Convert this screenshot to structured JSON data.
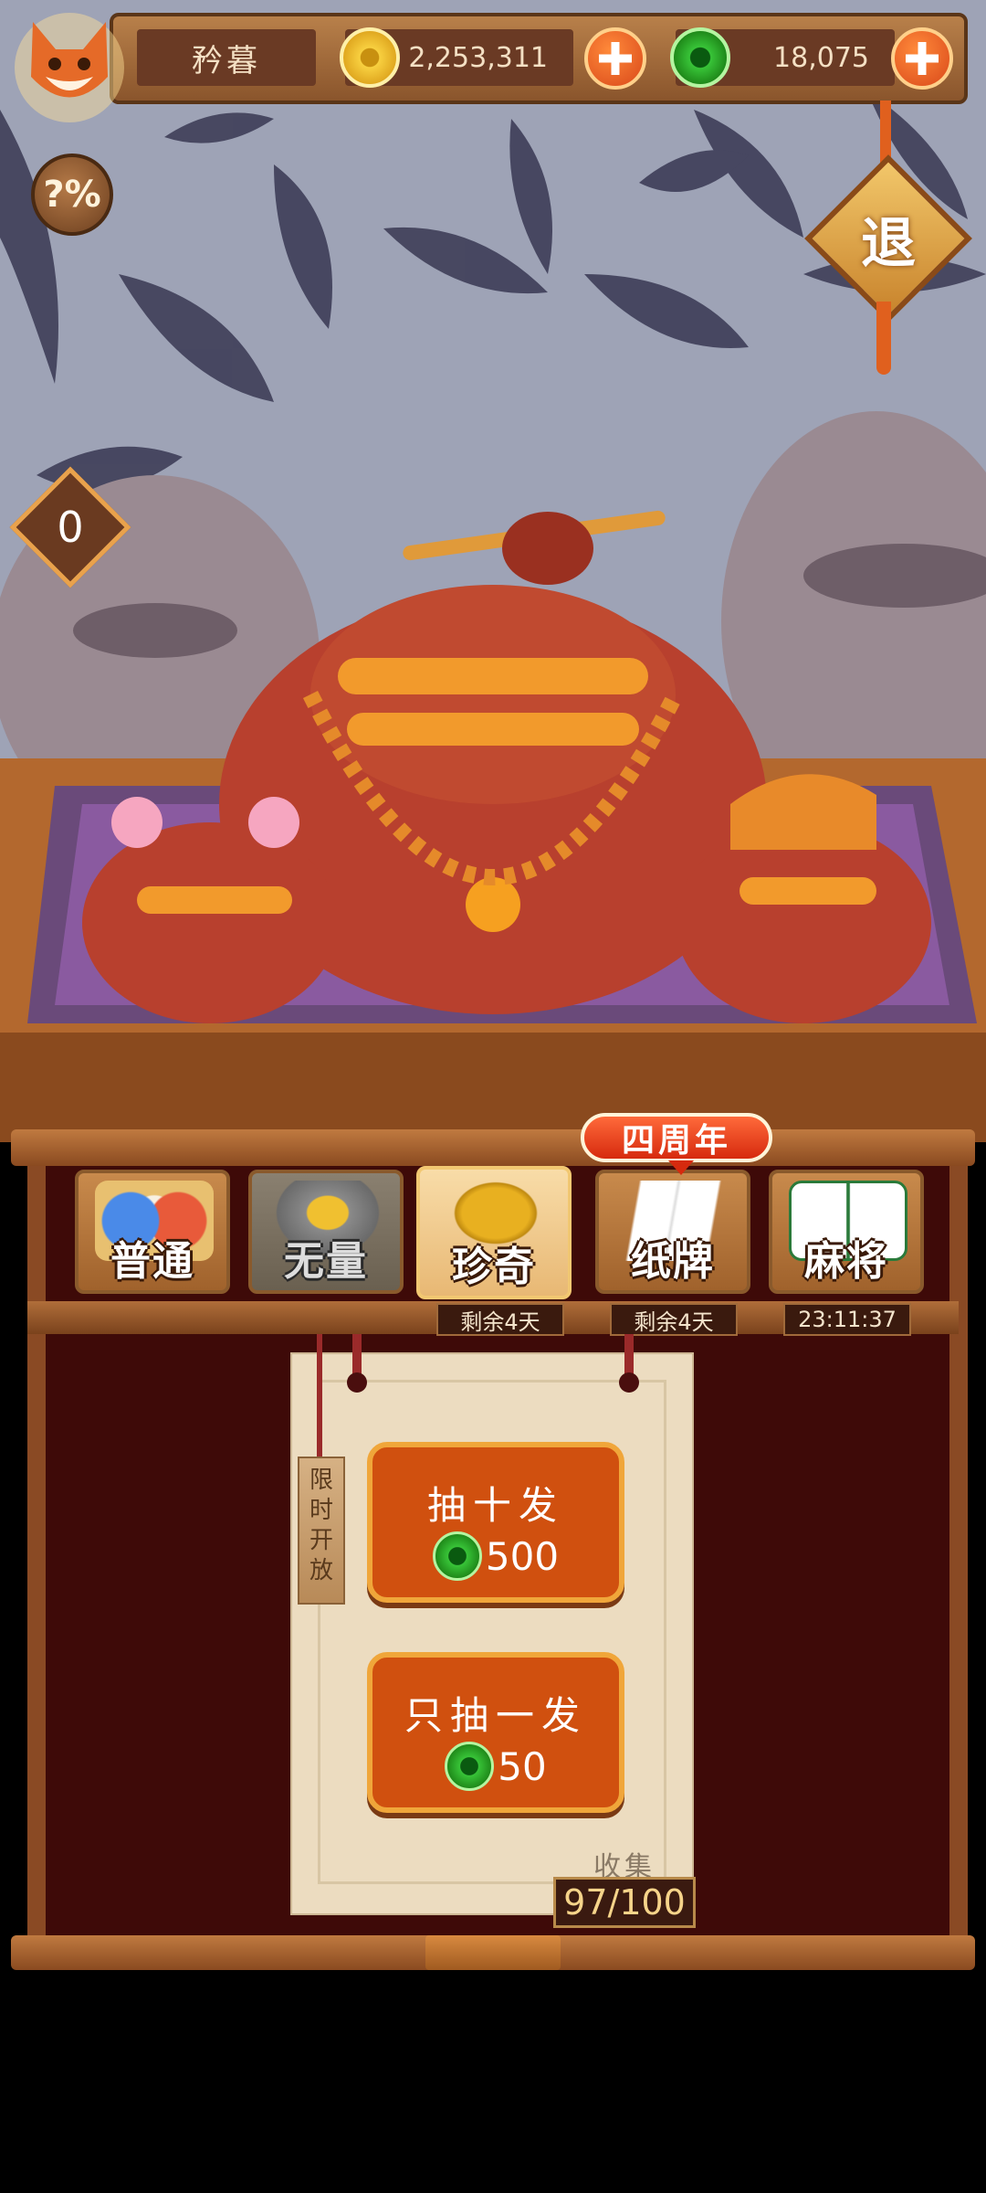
{
  "header": {
    "player_name": "矜暮",
    "coins": "2,253,311",
    "jade": "18,075"
  },
  "buttons": {
    "odds_label": "?%",
    "exit_label": "退"
  },
  "counter": "0",
  "tabs": [
    {
      "label": "普通",
      "active": false,
      "locked": false
    },
    {
      "label": "无量",
      "active": false,
      "locked": true
    },
    {
      "label": "珍奇",
      "active": true,
      "locked": false
    },
    {
      "label": "纸牌",
      "active": false,
      "locked": false
    },
    {
      "label": "麻将",
      "active": false,
      "locked": false
    }
  ],
  "tab_timers": {
    "zhenqi": "剩余4天",
    "zhipai": "剩余4天",
    "majiang": "23:11:37"
  },
  "anniversary_badge": "四周年",
  "limited_tag": "限时开放",
  "draw_ten": {
    "title": "抽十发",
    "cost": "500"
  },
  "draw_one": {
    "title": "只抽一发",
    "cost": "50"
  },
  "collection": {
    "label": "收集度",
    "value": "97/100"
  },
  "colors": {
    "accent": "#d0500f",
    "panel": "#3e0a08",
    "frame": "#8a4a24"
  }
}
